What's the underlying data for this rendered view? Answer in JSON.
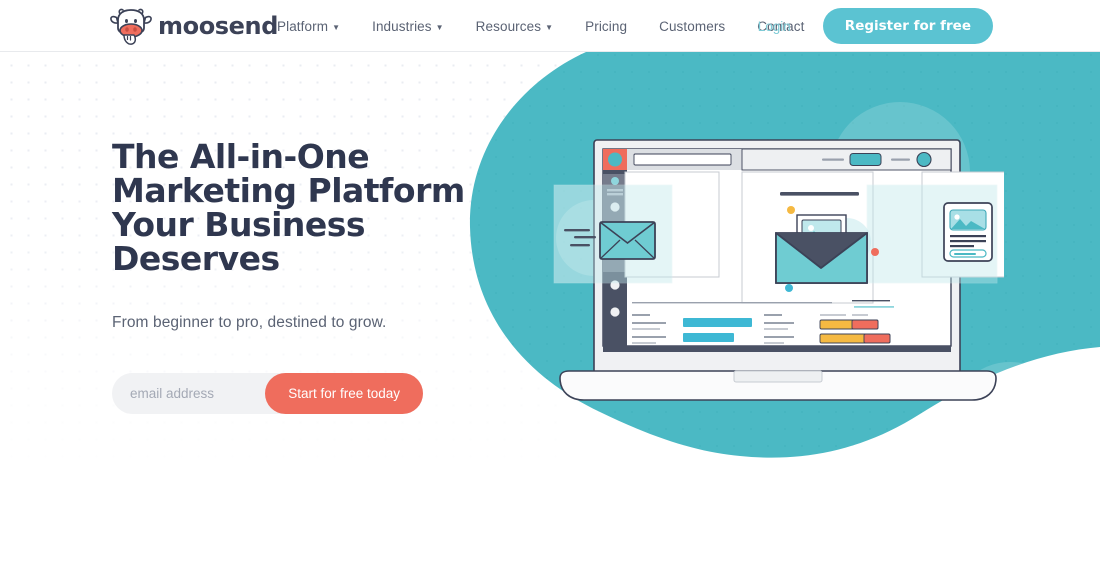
{
  "brand": {
    "name": "moosend",
    "logo_icon": "cow-head-icon",
    "accent_teal": "#4bb9c4",
    "accent_coral": "#ef6d5d",
    "text_dark": "#2f374f",
    "button_teal": "#5bc3d2"
  },
  "header": {
    "nav": [
      {
        "label": "Platform",
        "has_dropdown": true,
        "caret_icon": "chevron-down-icon"
      },
      {
        "label": "Industries",
        "has_dropdown": true,
        "caret_icon": "chevron-down-icon"
      },
      {
        "label": "Resources",
        "has_dropdown": true,
        "caret_icon": "chevron-down-icon"
      },
      {
        "label": "Pricing",
        "has_dropdown": false
      },
      {
        "label": "Customers",
        "has_dropdown": false
      },
      {
        "label": "Contact",
        "has_dropdown": false
      }
    ],
    "login_label": "Login",
    "register_label": "Register for free"
  },
  "hero": {
    "title": "The All-in-One Marketing Platform Your Business Deserves",
    "subtitle": "From beginner to pro, destined to grow.",
    "email_placeholder": "email address",
    "email_value": "",
    "cta_label": "Start for free today",
    "illustration_name": "laptop-email-marketing-illustration"
  }
}
